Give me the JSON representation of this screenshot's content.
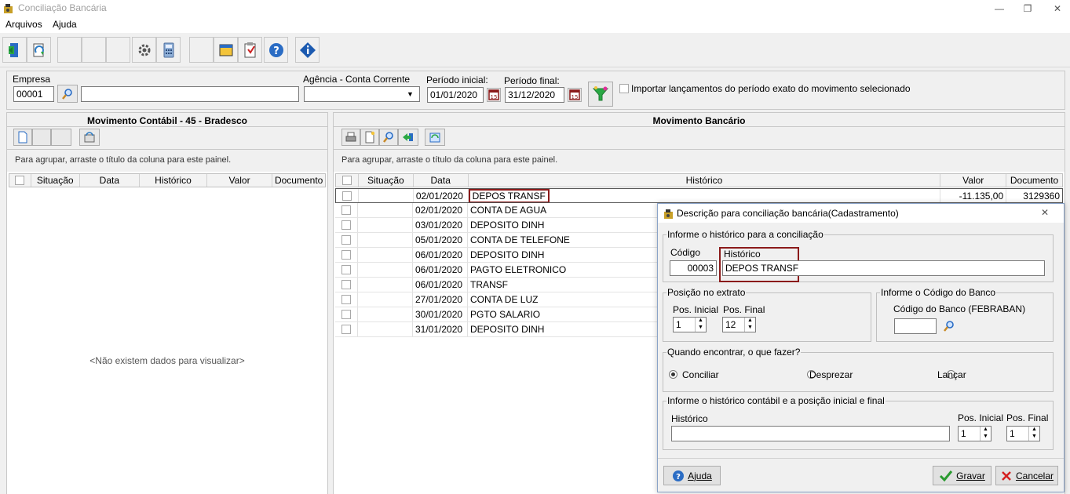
{
  "window": {
    "title": "Conciliação Bancária",
    "minimize": "—",
    "restore": "❐",
    "close": "✕"
  },
  "menu": [
    "Arquivos",
    "Ajuda"
  ],
  "filters": {
    "empresa_label": "Empresa",
    "empresa_code": "00001",
    "empresa_name": "",
    "agencia_label": "Agência - Conta Corrente",
    "agencia_value": "",
    "periodo_inicial_label": "Período inicial:",
    "periodo_inicial": "01/01/2020",
    "periodo_final_label": "Período final:",
    "periodo_final": "31/12/2020",
    "importar_label": "Importar lançamentos do período exato do movimento selecionado"
  },
  "left_panel": {
    "title": "Movimento Contábil - 45 - Bradesco",
    "group_hint": "Para agrupar, arraste o título da coluna para este painel.",
    "columns": [
      "Situação",
      "Data",
      "Histórico",
      "Valor",
      "Documento"
    ],
    "empty": "<Não existem dados para visualizar>"
  },
  "right_panel": {
    "title": "Movimento Bancário",
    "group_hint": "Para agrupar, arraste o título da coluna para este painel.",
    "columns": [
      "Situação",
      "Data",
      "Histórico",
      "Valor",
      "Documento"
    ],
    "rows": [
      {
        "data": "02/01/2020",
        "historico": "DEPOS TRANSF",
        "valor": "-11.135,00",
        "documento": "3129360"
      },
      {
        "data": "02/01/2020",
        "historico": "CONTA DE AGUA",
        "valor": "",
        "documento": ""
      },
      {
        "data": "03/01/2020",
        "historico": "DEPOSITO DINH",
        "valor": "",
        "documento": ""
      },
      {
        "data": "05/01/2020",
        "historico": "CONTA DE TELEFONE",
        "valor": "",
        "documento": ""
      },
      {
        "data": "06/01/2020",
        "historico": "DEPOSITO DINH",
        "valor": "",
        "documento": ""
      },
      {
        "data": "06/01/2020",
        "historico": "PAGTO ELETRONICO",
        "valor": "",
        "documento": ""
      },
      {
        "data": "06/01/2020",
        "historico": "TRANSF",
        "valor": "",
        "documento": ""
      },
      {
        "data": "27/01/2020",
        "historico": "CONTA DE LUZ",
        "valor": "",
        "documento": ""
      },
      {
        "data": "30/01/2020",
        "historico": "PGTO SALARIO",
        "valor": "",
        "documento": ""
      },
      {
        "data": "31/01/2020",
        "historico": "DEPOSITO DINH",
        "valor": "",
        "documento": ""
      }
    ]
  },
  "dialog": {
    "title": "Descrição para conciliação bancária(Cadastramento)",
    "group_historico": "Informe o histórico para a conciliação",
    "codigo_label": "Código",
    "codigo_value": "00003",
    "historico_label": "Histórico",
    "historico_value": "DEPOS TRANSF",
    "group_posicao": "Posição no extrato",
    "pos_inicial_label": "Pos. Inicial",
    "pos_inicial_value": "1",
    "pos_final_label": "Pos. Final",
    "pos_final_value": "12",
    "group_banco": "Informe o Código do Banco",
    "codigo_banco_label": "Código do Banco (FEBRABAN)",
    "codigo_banco_value": "",
    "group_acao": "Quando encontrar, o que fazer?",
    "opcoes": [
      "Conciliar",
      "Desprezar",
      "Lançar"
    ],
    "group_contabil": "Informe o histórico contábil e a posição inicial e final",
    "contabil_historico_label": "Histórico",
    "contabil_historico_value": "",
    "contabil_pos_inicial_label": "Pos. Inicial",
    "contabil_pos_inicial_value": "1",
    "contabil_pos_final_label": "Pos. Final",
    "contabil_pos_final_value": "1",
    "ajuda_button": "Ajuda",
    "gravar_button": "Gravar",
    "cancelar_button": "Cancelar"
  }
}
